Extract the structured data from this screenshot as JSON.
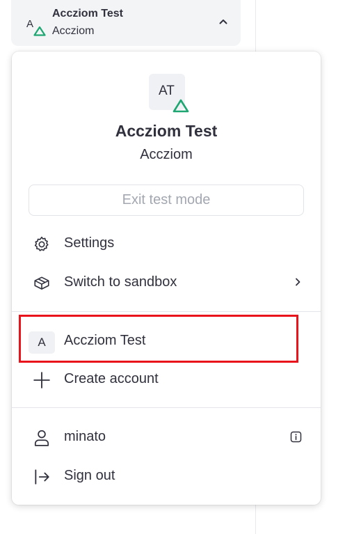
{
  "switcher": {
    "name": "Accziom Test",
    "sub": "Accziom",
    "avatar_letter": "A",
    "chevron_icon": "chevron-up-icon"
  },
  "menu": {
    "avatar_initials": "AT",
    "account_name": "Accziom Test",
    "account_sub": "Accziom",
    "exit_label": "Exit test mode",
    "items": [
      {
        "label": "Settings",
        "icon": "gear-icon"
      },
      {
        "label": "Switch to sandbox",
        "icon": "cube-icon",
        "trailing_icon": "chevron-right-icon"
      }
    ],
    "accounts": [
      {
        "letter": "A",
        "label": "Accziom Test"
      }
    ],
    "create_account": {
      "label": "Create account",
      "icon": "plus-icon"
    },
    "user": {
      "label": "minato",
      "icon": "user-icon",
      "trailing_icon": "info-icon"
    },
    "sign_out": {
      "label": "Sign out",
      "icon": "sign-out-icon"
    }
  },
  "colors": {
    "test_mode_triangle": "#1ea672",
    "highlight": "#e8131b",
    "text": "#30313d",
    "muted": "#a3a7b0"
  }
}
